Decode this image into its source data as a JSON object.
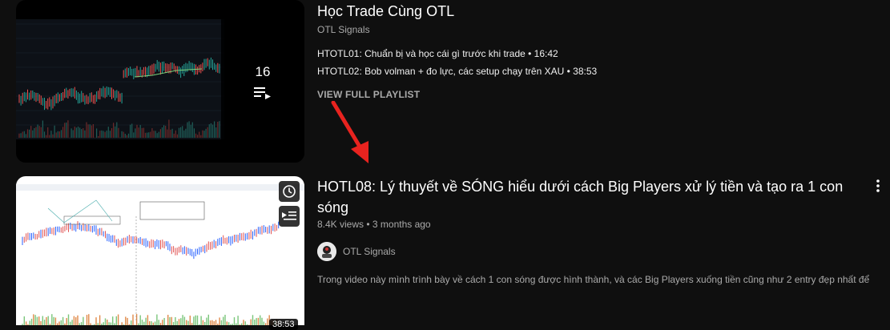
{
  "playlist": {
    "title": "Học Trade Cùng OTL",
    "channel": "OTL Signals",
    "video_count": "16",
    "items": [
      "HTOTL01: Chuẩn bị và học cái gì trước khi trade • 16:42",
      "HTOTL02: Bob volman + đo lực, các setup chạy trên XAU • 38:53"
    ],
    "view_full_label": "VIEW FULL PLAYLIST"
  },
  "video": {
    "title": "HOTL08: Lý thuyết về SÓNG hiểu dưới cách Big Players xử lý tiền và tạo ra 1 con sóng",
    "meta": "8.4K views • 3 months ago",
    "channel": "OTL Signals",
    "description": "Trong video này mình trình bày về cách 1 con sóng được hình thành, và các Big Players xuống tiền cũng như 2 entry đẹp nhất để ...",
    "duration": "38:53"
  },
  "colors": {
    "background": "#0f0f0f",
    "arrow": "#e8231f",
    "secondary_text": "#aaaaaa"
  },
  "icons": [
    "playlist-icon",
    "clock-icon",
    "add-to-queue-icon",
    "more-vert-icon",
    "channel-avatar"
  ]
}
